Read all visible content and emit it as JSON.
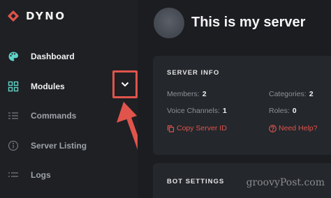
{
  "brand": {
    "name": "DYNO",
    "logo_icon": "dyno-diamond-logo",
    "accent": "#e0544b"
  },
  "sidebar": {
    "items": [
      {
        "label": "Dashboard",
        "icon": "palette-icon",
        "active": true
      },
      {
        "label": "Modules",
        "icon": "modules-grid-icon",
        "active": true,
        "expander_icon": "chevron-down-icon"
      },
      {
        "label": "Commands",
        "icon": "commands-icon",
        "active": false
      },
      {
        "label": "Server Listing",
        "icon": "info-circle-icon",
        "active": false
      },
      {
        "label": "Logs",
        "icon": "logs-list-icon",
        "active": false
      }
    ]
  },
  "server": {
    "title": "This is my server"
  },
  "server_info": {
    "title": "SERVER INFO",
    "members_label": "Members:",
    "members_value": "2",
    "categories_label": "Categories:",
    "categories_value": "2",
    "voice_label": "Voice Channels:",
    "voice_value": "1",
    "roles_label": "Roles:",
    "roles_value": "0",
    "copy_link": "Copy Server ID",
    "help_link": "Need Help?"
  },
  "bot_settings": {
    "title": "BOT SETTINGS"
  },
  "watermark": "groovyPost.com",
  "colors": {
    "sidebar_bg": "#1e2024",
    "main_bg": "#1b1d21",
    "card_bg": "#24272c",
    "annotation": "#e0544b"
  }
}
